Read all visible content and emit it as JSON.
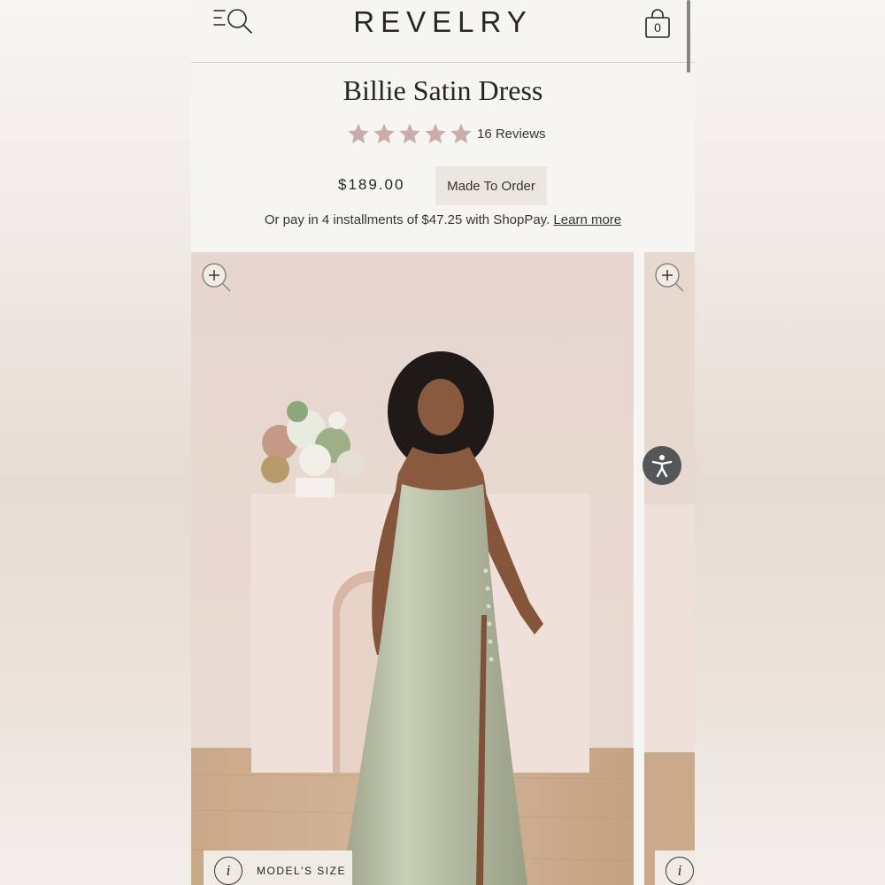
{
  "brand": {
    "logo": "REVELRY"
  },
  "header": {
    "cart_count": "0"
  },
  "product": {
    "title": "Billie Satin Dress",
    "rating": 5,
    "reviews_label": "16 Reviews",
    "price": "$189.00",
    "badge": "Made To Order",
    "installments_text": "Or pay in 4 installments of $47.25 with ShopPay.",
    "learn_more": "Learn more"
  },
  "gallery": {
    "model_size_info": "i",
    "model_size_label": "MODEL'S SIZE",
    "next_info": "i"
  },
  "colors": {
    "star": "#c9ada8",
    "dress": "#b5bda4",
    "backdrop": "#e8d9d2",
    "floor": "#c9a98a",
    "accessibility_button": "#545658"
  },
  "icons": [
    "menu-icon",
    "search-icon",
    "cart-icon",
    "star-icon",
    "zoom-in-icon",
    "info-icon",
    "accessibility-icon"
  ]
}
